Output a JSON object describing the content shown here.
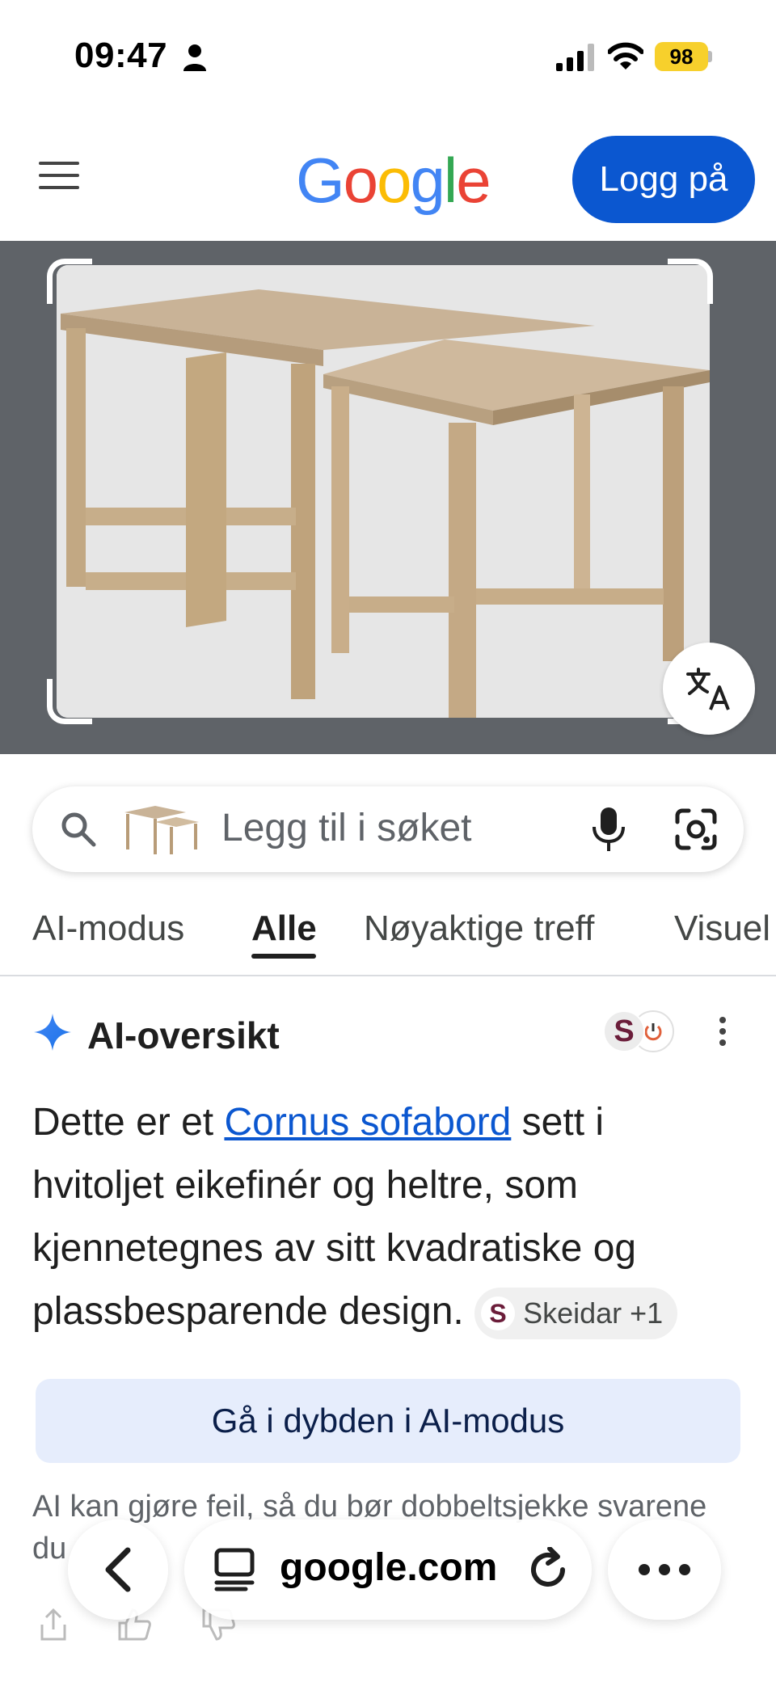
{
  "status_bar": {
    "time": "09:47",
    "battery": "98",
    "icons": [
      "person-icon",
      "signal-icon",
      "wifi-icon",
      "battery-icon"
    ]
  },
  "header": {
    "logo_letters": [
      {
        "ch": "G",
        "color": "#4285F4"
      },
      {
        "ch": "o",
        "color": "#EA4335"
      },
      {
        "ch": "o",
        "color": "#FBBC05"
      },
      {
        "ch": "g",
        "color": "#4285F4"
      },
      {
        "ch": "l",
        "color": "#34A853"
      },
      {
        "ch": "e",
        "color": "#EA4335"
      }
    ],
    "login_label": "Logg på"
  },
  "search": {
    "placeholder": "Legg til i søket"
  },
  "tabs": [
    {
      "label": "AI-modus",
      "active": false
    },
    {
      "label": "Alle",
      "active": true
    },
    {
      "label": "Nøyaktige treff",
      "active": false
    },
    {
      "label": "Visuel",
      "active": false
    }
  ],
  "ai_overview": {
    "title": "AI-oversikt",
    "text_before": "Dette er et ",
    "link_text": "Cornus sofabord",
    "text_after": " sett i hvitoljet eikefinér og heltre, som kjennetegnes av sitt kvadratiske og plassbesparende design. ",
    "source_chip": {
      "avatar_letter": "S",
      "label": "Skeidar +1"
    },
    "source_avatar_letter": "S",
    "deep_dive_label": "Gå i dybden i AI-modus",
    "disclaimer": "AI kan gjøre feil, så du bør dobbeltsjekke svarene du"
  },
  "browser": {
    "url": "google.com"
  },
  "colors": {
    "accent": "#0b57d0",
    "battery": "#f7d02c",
    "image_backdrop": "#5f6368"
  }
}
